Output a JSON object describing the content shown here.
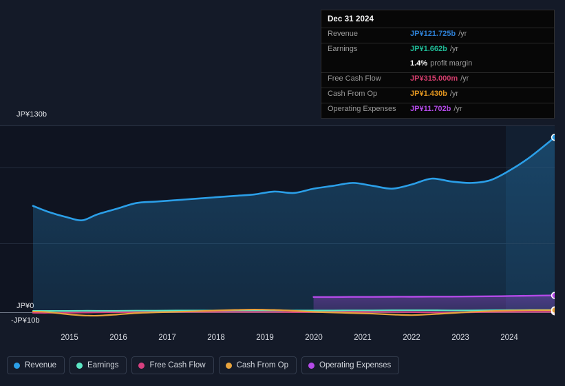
{
  "chart_data": {
    "type": "area",
    "title": "",
    "xlabel": "",
    "ylabel": "",
    "currency": "JP¥",
    "grid": true,
    "legend_position": "bottom-left",
    "ylim": [
      -10,
      130
    ],
    "y_ticks": [
      {
        "label": "JP¥130b",
        "value": 130
      },
      {
        "label": "JP¥0",
        "value": 0
      },
      {
        "label": "-JP¥10b",
        "value": -10
      }
    ],
    "x_ticks": [
      "2015",
      "2016",
      "2017",
      "2018",
      "2019",
      "2020",
      "2021",
      "2022",
      "2023",
      "2024"
    ],
    "x": [
      2014.3,
      2014.6,
      2015.0,
      2015.3,
      2015.6,
      2016.0,
      2016.4,
      2016.8,
      2017.2,
      2017.6,
      2018.0,
      2018.4,
      2018.8,
      2019.2,
      2019.6,
      2020.0,
      2020.4,
      2020.8,
      2021.2,
      2021.6,
      2022.0,
      2022.4,
      2022.8,
      2023.2,
      2023.6,
      2024.0,
      2024.4,
      2024.9
    ],
    "series": [
      {
        "name": "Revenue",
        "color": "#2b9fe8",
        "unit": "b",
        "values": [
          74,
          70,
          66,
          64,
          68,
          72,
          76,
          77,
          78,
          79,
          80,
          81,
          82,
          84,
          83,
          86,
          88,
          90,
          88,
          86,
          89,
          93,
          91,
          90,
          92,
          99,
          108,
          121.725
        ]
      },
      {
        "name": "Earnings",
        "color": "#5ce6c4",
        "unit": "b",
        "values": [
          0.9,
          0.9,
          0.9,
          1.0,
          1.0,
          1.0,
          1.1,
          1.1,
          1.2,
          1.2,
          1.2,
          1.3,
          1.3,
          1.3,
          1.2,
          1.2,
          1.2,
          1.3,
          1.3,
          1.4,
          1.4,
          1.4,
          1.3,
          1.3,
          1.4,
          1.5,
          1.6,
          1.662
        ]
      },
      {
        "name": "Free Cash Flow",
        "color": "#d6407f",
        "unit": "m",
        "values": [
          -0.4,
          -0.4,
          -0.3,
          -0.2,
          -0.1,
          0.0,
          0.1,
          0.2,
          0.2,
          0.3,
          0.3,
          0.3,
          0.2,
          0.2,
          0.1,
          0.1,
          0.2,
          0.3,
          0.3,
          0.2,
          0.1,
          -0.1,
          -0.2,
          0.0,
          0.2,
          0.3,
          0.3,
          0.315
        ]
      },
      {
        "name": "Cash From Op",
        "color": "#e8a33d",
        "unit": "b",
        "values": [
          0.5,
          0.1,
          -1.4,
          -2.2,
          -2.4,
          -1.6,
          -0.6,
          -0.1,
          0.3,
          0.7,
          1.2,
          1.6,
          1.9,
          1.6,
          1.0,
          0.3,
          -0.2,
          -0.6,
          -1.0,
          -1.6,
          -2.0,
          -1.4,
          -0.6,
          0.2,
          0.8,
          1.2,
          1.4,
          1.43
        ]
      },
      {
        "name": "Operating Expenses",
        "color": "#b44ae8",
        "unit": "b",
        "values": [
          null,
          null,
          null,
          null,
          null,
          null,
          null,
          null,
          null,
          null,
          null,
          null,
          null,
          null,
          null,
          10.6,
          10.6,
          10.7,
          10.7,
          10.8,
          10.8,
          10.9,
          10.9,
          11.0,
          11.1,
          11.3,
          11.5,
          11.702
        ]
      }
    ],
    "endpoint_markers": true,
    "highlight_region": {
      "from": 2023.8,
      "to": 2024.9,
      "label": "recent"
    }
  },
  "tooltip": {
    "date": "Dec 31 2024",
    "rows": [
      {
        "label": "Revenue",
        "value": "JP¥121.725b",
        "unit": "/yr",
        "color": "#2d7fd4"
      },
      {
        "label": "Earnings",
        "value": "JP¥1.662b",
        "unit": "/yr",
        "color": "#1fb894"
      },
      {
        "label": "Free Cash Flow",
        "value": "JP¥315.000m",
        "unit": "/yr",
        "color": "#d13c6b"
      },
      {
        "label": "Cash From Op",
        "value": "JP¥1.430b",
        "unit": "/yr",
        "color": "#e0941f"
      },
      {
        "label": "Operating Expenses",
        "value": "JP¥11.702b",
        "unit": "/yr",
        "color": "#b44ae8"
      }
    ],
    "sub_row": {
      "value": "1.4%",
      "unit": "profit margin"
    }
  },
  "legend": {
    "items": [
      {
        "label": "Revenue",
        "color": "#2b9fe8"
      },
      {
        "label": "Earnings",
        "color": "#5ce6c4"
      },
      {
        "label": "Free Cash Flow",
        "color": "#d6407f"
      },
      {
        "label": "Cash From Op",
        "color": "#e8a33d"
      },
      {
        "label": "Operating Expenses",
        "color": "#b44ae8"
      }
    ]
  },
  "axis": {
    "y_top_label": "JP¥130b",
    "y_zero_label": "JP¥0",
    "y_bottom_label": "-JP¥10b",
    "x_labels": [
      "2015",
      "2016",
      "2017",
      "2018",
      "2019",
      "2020",
      "2021",
      "2022",
      "2023",
      "2024"
    ]
  }
}
